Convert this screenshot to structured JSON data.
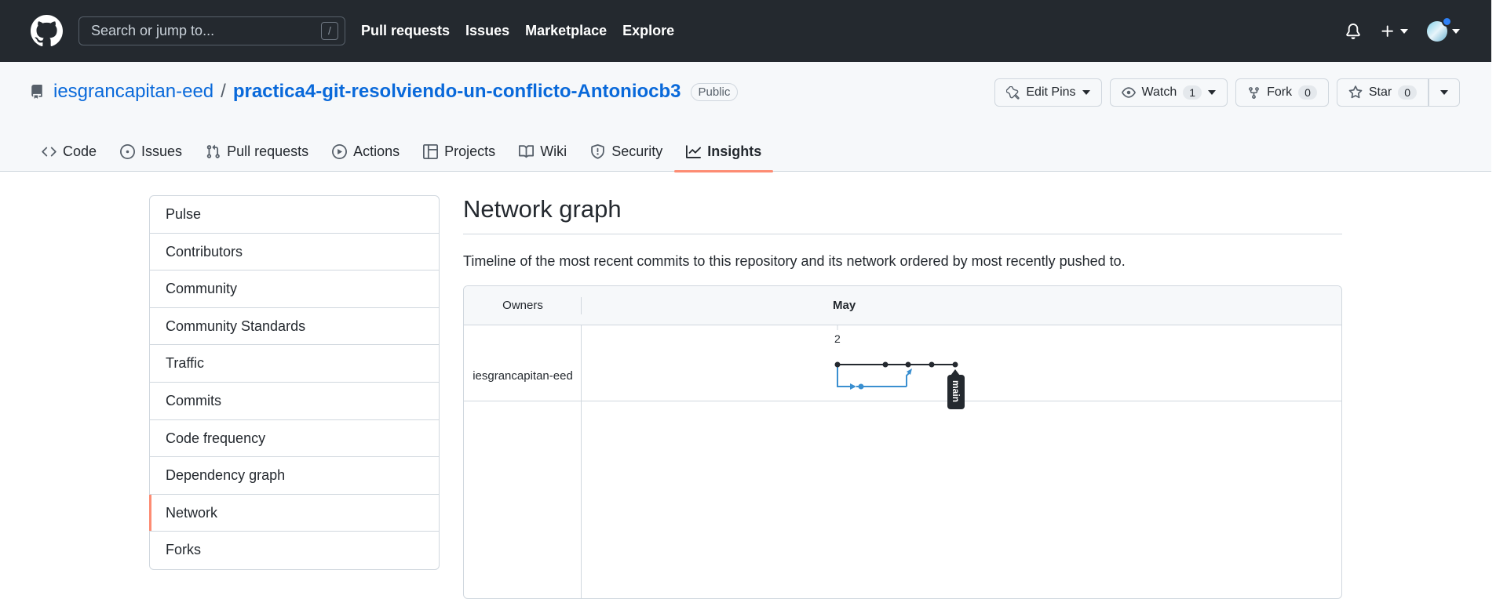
{
  "header": {
    "search_placeholder": "Search or jump to...",
    "search_shortcut": "/",
    "nav": [
      "Pull requests",
      "Issues",
      "Marketplace",
      "Explore"
    ]
  },
  "repo": {
    "owner": "iesgrancapitan-eed",
    "separator": "/",
    "name": "practica4-git-resolviendo-un-conflicto-Antoniocb3",
    "visibility": "Public",
    "actions": {
      "edit_pins": "Edit Pins",
      "watch": "Watch",
      "watch_count": "1",
      "fork": "Fork",
      "fork_count": "0",
      "star": "Star",
      "star_count": "0"
    },
    "tabs": [
      "Code",
      "Issues",
      "Pull requests",
      "Actions",
      "Projects",
      "Wiki",
      "Security",
      "Insights"
    ]
  },
  "sidebar": {
    "items": [
      "Pulse",
      "Contributors",
      "Community",
      "Community Standards",
      "Traffic",
      "Commits",
      "Code frequency",
      "Dependency graph",
      "Network",
      "Forks"
    ],
    "selected": "Network"
  },
  "main": {
    "title": "Network graph",
    "description": "Timeline of the most recent commits to this repository and its network ordered by most recently pushed to."
  },
  "network": {
    "owners_header": "Owners",
    "month": "May",
    "day": "2",
    "owner": "iesgrancapitan-eed",
    "branch_label": "main"
  },
  "colors": {
    "header_bg": "#24292f",
    "link": "#0969da",
    "accent_underline": "#fd8c73",
    "branch_main": "#24292f",
    "branch_side": "#3a8fd0"
  }
}
